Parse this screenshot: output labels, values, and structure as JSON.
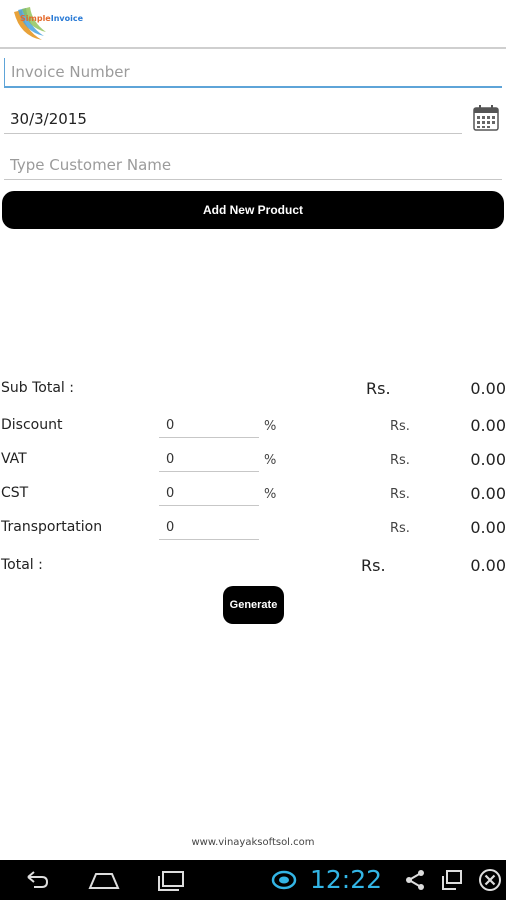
{
  "header": {
    "logo_word_1": "Simple",
    "logo_word_2": "Invoice"
  },
  "form": {
    "invoice_number_placeholder": "Invoice Number",
    "date_value": "30/3/2015",
    "customer_placeholder": "Type Customer Name",
    "add_product_label": "Add New Product"
  },
  "summary": {
    "subtotal_label": "Sub Total :",
    "subtotal_currency": "Rs.",
    "subtotal_amount": "0.00",
    "discount_label": "Discount",
    "discount_value": "0",
    "discount_unit": "%",
    "discount_currency": "Rs.",
    "discount_amount": "0.00",
    "vat_label": "VAT",
    "vat_value": "0",
    "vat_unit": "%",
    "vat_currency": "Rs.",
    "vat_amount": "0.00",
    "cst_label": "CST",
    "cst_value": "0",
    "cst_unit": "%",
    "cst_currency": "Rs.",
    "cst_amount": "0.00",
    "transport_label": "Transportation",
    "transport_value": "0",
    "transport_currency": "Rs.",
    "transport_amount": "0.00",
    "total_label": "Total :",
    "total_currency": "Rs.",
    "total_amount": "0.00"
  },
  "actions": {
    "generate_label": "Generate"
  },
  "footer": {
    "website": "www.vinayaksoftsol.com"
  },
  "system_bar": {
    "time": "12:22"
  },
  "colors": {
    "accent": "#33b5e5",
    "focus_underline": "#5ea4d8",
    "button_bg": "#000000"
  }
}
